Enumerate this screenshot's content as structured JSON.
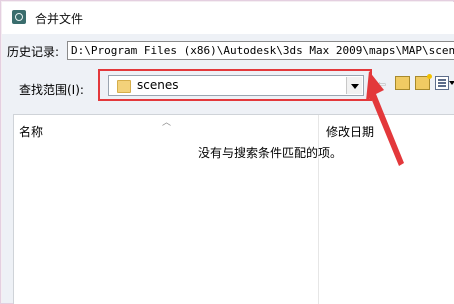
{
  "window": {
    "title": "合并文件",
    "icon": "3dsmax-app-icon"
  },
  "history": {
    "label": "历史记录:",
    "path": "D:\\Program Files (x86)\\Autodesk\\3ds Max 2009\\maps\\MAP\\scen"
  },
  "lookin": {
    "label": "查找范围(I):",
    "value": "scenes",
    "icon": "folder-icon"
  },
  "toolbar": {
    "icons": [
      "back-arrow-icon",
      "up-folder-icon",
      "new-folder-icon",
      "view-menu-icon"
    ]
  },
  "list": {
    "columns": [
      "名称",
      "修改日期"
    ],
    "empty_message": "没有与搜索条件匹配的项。"
  },
  "annotation": {
    "highlight_color": "#e3383b"
  }
}
